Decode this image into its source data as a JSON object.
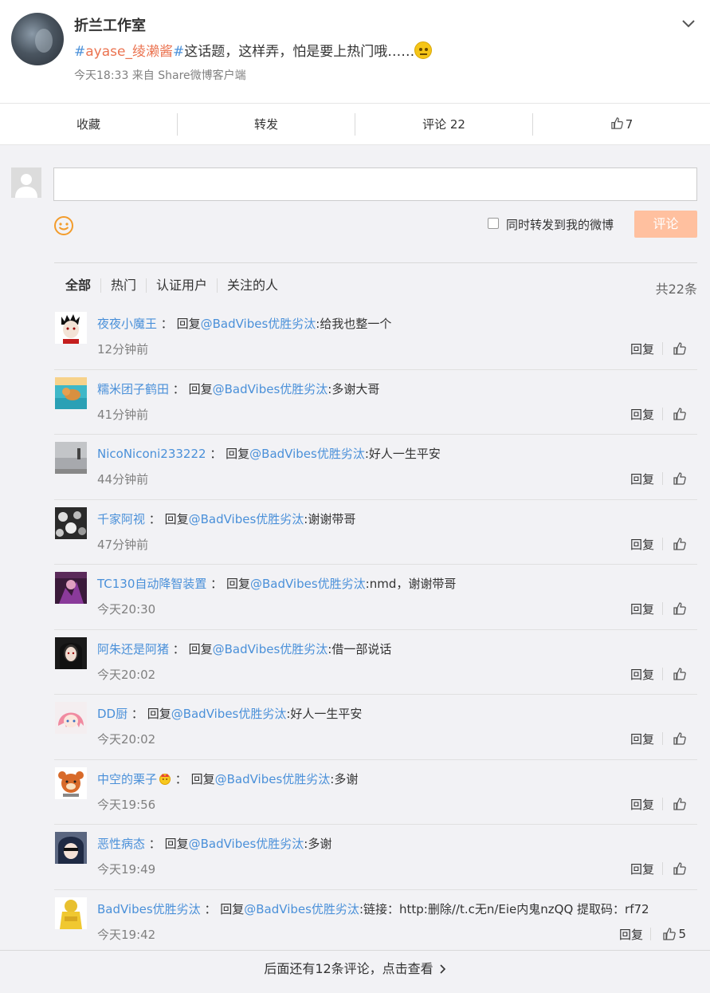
{
  "post": {
    "author": "折兰工作室",
    "text_hash_open": "#",
    "text_topic": "ayase_绫濑酱",
    "text_hash_close": "#",
    "text_body": "这话题，这样弄，怕是要上热门哦……",
    "meta": "今天18:33 来自 Share微博客户端"
  },
  "actions": {
    "favorite": "收藏",
    "forward": "转发",
    "comments": "评论 22",
    "likes": "7"
  },
  "composer": {
    "forward_label": "同时转发到我的微博",
    "submit_label": "评论"
  },
  "filters": {
    "all": "全部",
    "hot": "热门",
    "verified": "认证用户",
    "following": "关注的人",
    "total": "共22条"
  },
  "comments": [
    {
      "user": "夜夜小魔王",
      "sep": "：",
      "prefix": "回复",
      "mention": "@BadVibes优胜劣汰",
      "text": ":给我也整一个",
      "time": "12分钟前",
      "reply": "回复",
      "likes": ""
    },
    {
      "user": "糯米团子鹤田",
      "sep": "：",
      "prefix": "回复",
      "mention": "@BadVibes优胜劣汰",
      "text": ":多谢大哥",
      "time": "41分钟前",
      "reply": "回复",
      "likes": ""
    },
    {
      "user": "NicoNiconi233222",
      "sep": "：",
      "prefix": "回复",
      "mention": "@BadVibes优胜劣汰",
      "text": ":好人一生平安",
      "time": "44分钟前",
      "reply": "回复",
      "likes": ""
    },
    {
      "user": "千家阿视",
      "sep": "：",
      "prefix": "回复",
      "mention": "@BadVibes优胜劣汰",
      "text": ":谢谢带哥",
      "time": "47分钟前",
      "reply": "回复",
      "likes": ""
    },
    {
      "user": "TC130自动降智装置",
      "sep": "：",
      "prefix": "回复",
      "mention": "@BadVibes优胜劣汰",
      "text": ":nmd，谢谢带哥",
      "time": "今天20:30",
      "reply": "回复",
      "likes": ""
    },
    {
      "user": "阿朱还是阿猪",
      "sep": "：",
      "prefix": "回复",
      "mention": "@BadVibes优胜劣汰",
      "text": ":借一部说话",
      "time": "今天20:02",
      "reply": "回复",
      "likes": ""
    },
    {
      "user": "DD厨",
      "sep": "：",
      "prefix": "回复",
      "mention": "@BadVibes优胜劣汰",
      "text": ":好人一生平安",
      "time": "今天20:02",
      "reply": "回复",
      "likes": ""
    },
    {
      "user": "中空的栗子",
      "sep": "：",
      "prefix": "回复",
      "mention": "@BadVibes优胜劣汰",
      "text": ":多谢",
      "time": "今天19:56",
      "reply": "回复",
      "likes": ""
    },
    {
      "user": "恶性病态",
      "sep": "：",
      "prefix": "回复",
      "mention": "@BadVibes优胜劣汰",
      "text": ":多谢",
      "time": "今天19:49",
      "reply": "回复",
      "likes": ""
    },
    {
      "user": "BadVibes优胜劣汰",
      "sep": "：",
      "prefix": "回复",
      "mention": "@BadVibes优胜劣汰",
      "text": ":链接：http:删除//t.c无n/Eie内鬼nzQQ 提取码：rf72",
      "time": "今天19:42",
      "reply": "回复",
      "likes": "5"
    }
  ],
  "more": "后面还有12条评论，点击查看",
  "icons": [
    "chevron-down-icon",
    "thumb-up-icon",
    "smile-icon",
    "crown-icon",
    "chevron-right-icon"
  ],
  "colors": {
    "link": "#4a90d9",
    "topic": "#eb7350",
    "button": "#ffc09f"
  }
}
